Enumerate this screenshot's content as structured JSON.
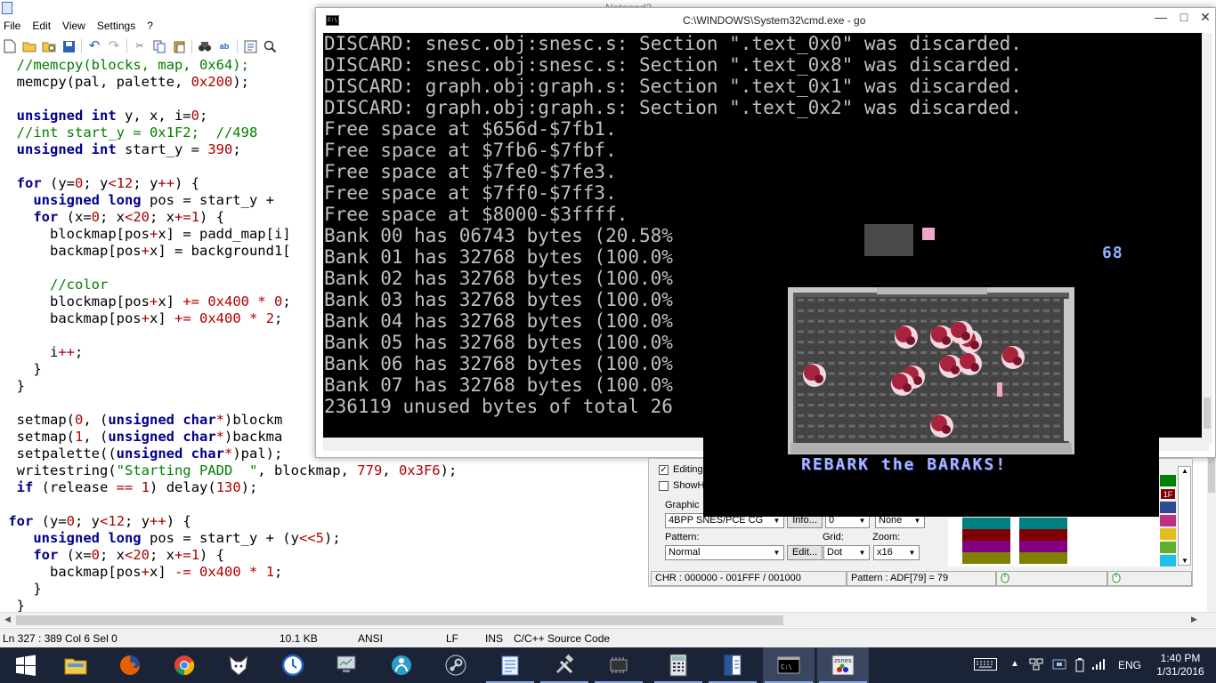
{
  "notepad": {
    "title": "Notepad2",
    "menu": [
      "File",
      "Edit",
      "View",
      "Settings",
      "?"
    ],
    "toolbar_icons": [
      "new-icon",
      "open-icon",
      "browse-icon",
      "save-icon",
      "undo-icon",
      "redo-icon",
      "cut-icon",
      "copy-icon",
      "paste-icon",
      "find-icon",
      "replace-icon",
      "word-wrap-icon",
      "zoom-icon"
    ],
    "code_lines": [
      [
        [
          "  ",
          ""
        ],
        [
          "//memcpy(blocks, map, 0x64);",
          "cm"
        ]
      ],
      [
        [
          "  memcpy(pal, palette, ",
          ""
        ],
        [
          "0x200",
          "nm"
        ],
        [
          ");",
          ""
        ]
      ],
      [
        [
          "",
          ""
        ]
      ],
      [
        [
          "  ",
          ""
        ],
        [
          "unsigned int",
          "kw"
        ],
        [
          " y, x, i=",
          ""
        ],
        [
          "0",
          "nm"
        ],
        [
          ";",
          ""
        ]
      ],
      [
        [
          "  ",
          ""
        ],
        [
          "//int start_y = 0x1F2;  //498",
          "cm"
        ]
      ],
      [
        [
          "  ",
          ""
        ],
        [
          "unsigned int",
          "kw"
        ],
        [
          " start_y = ",
          ""
        ],
        [
          "390",
          "nm"
        ],
        [
          ";",
          ""
        ]
      ],
      [
        [
          "",
          ""
        ]
      ],
      [
        [
          "  ",
          ""
        ],
        [
          "for",
          "kw"
        ],
        [
          " (y=",
          ""
        ],
        [
          "0",
          "nm"
        ],
        [
          "; y",
          ""
        ],
        [
          "<",
          "op"
        ],
        [
          "12",
          "nm"
        ],
        [
          "; y",
          ""
        ],
        [
          "++",
          "op"
        ],
        [
          ") {",
          ""
        ]
      ],
      [
        [
          "    ",
          ""
        ],
        [
          "unsigned long",
          "kw"
        ],
        [
          " pos = start_y + ",
          ""
        ]
      ],
      [
        [
          "    ",
          ""
        ],
        [
          "for",
          "kw"
        ],
        [
          " (x=",
          ""
        ],
        [
          "0",
          "nm"
        ],
        [
          "; x",
          ""
        ],
        [
          "<",
          "op"
        ],
        [
          "20",
          "nm"
        ],
        [
          "; x",
          ""
        ],
        [
          "+=",
          "op"
        ],
        [
          "1",
          "nm"
        ],
        [
          ") {",
          ""
        ]
      ],
      [
        [
          "      blockmap[pos",
          ""
        ],
        [
          "+",
          "op"
        ],
        [
          "x] = padd_map[i]",
          ""
        ]
      ],
      [
        [
          "      backmap[pos",
          ""
        ],
        [
          "+",
          "op"
        ],
        [
          "x] = background1[",
          ""
        ]
      ],
      [
        [
          "",
          ""
        ]
      ],
      [
        [
          "      ",
          ""
        ],
        [
          "//color",
          "cm"
        ]
      ],
      [
        [
          "      blockmap[pos",
          ""
        ],
        [
          "+",
          "op"
        ],
        [
          "x] ",
          ""
        ],
        [
          "+=",
          "op"
        ],
        [
          " ",
          ""
        ],
        [
          "0x400",
          "nm"
        ],
        [
          " ",
          ""
        ],
        [
          "*",
          "op"
        ],
        [
          " ",
          ""
        ],
        [
          "0",
          "nm"
        ],
        [
          ";",
          ""
        ]
      ],
      [
        [
          "      backmap[pos",
          ""
        ],
        [
          "+",
          "op"
        ],
        [
          "x] ",
          ""
        ],
        [
          "+=",
          "op"
        ],
        [
          " ",
          ""
        ],
        [
          "0x400",
          "nm"
        ],
        [
          " ",
          ""
        ],
        [
          "*",
          "op"
        ],
        [
          " ",
          ""
        ],
        [
          "2",
          "nm"
        ],
        [
          ";",
          ""
        ]
      ],
      [
        [
          "",
          ""
        ]
      ],
      [
        [
          "      i",
          ""
        ],
        [
          "++",
          "op"
        ],
        [
          ";",
          ""
        ]
      ],
      [
        [
          "    }",
          ""
        ]
      ],
      [
        [
          "  }",
          ""
        ]
      ],
      [
        [
          "",
          ""
        ]
      ],
      [
        [
          "  setmap(",
          ""
        ],
        [
          "0",
          "nm"
        ],
        [
          ", (",
          ""
        ],
        [
          "unsigned char",
          "kw"
        ],
        [
          "*",
          "op"
        ],
        [
          ")blockm",
          ""
        ]
      ],
      [
        [
          "  setmap(",
          ""
        ],
        [
          "1",
          "nm"
        ],
        [
          ", (",
          ""
        ],
        [
          "unsigned char",
          "kw"
        ],
        [
          "*",
          "op"
        ],
        [
          ")backma",
          ""
        ]
      ],
      [
        [
          "  setpalette((",
          ""
        ],
        [
          "unsigned char",
          "kw"
        ],
        [
          "*",
          "op"
        ],
        [
          ")pal);",
          ""
        ]
      ],
      [
        [
          "  writestring(",
          ""
        ],
        [
          "\"Starting PADD  \"",
          "st"
        ],
        [
          ", blockmap, ",
          ""
        ],
        [
          "779",
          "nm"
        ],
        [
          ", ",
          ""
        ],
        [
          "0x3F6",
          "nm"
        ],
        [
          ");",
          ""
        ]
      ],
      [
        [
          "  ",
          ""
        ],
        [
          "if",
          "kw"
        ],
        [
          " (release ",
          ""
        ],
        [
          "==",
          "op"
        ],
        [
          " ",
          ""
        ],
        [
          "1",
          "nm"
        ],
        [
          ") delay(",
          ""
        ],
        [
          "130",
          "nm"
        ],
        [
          ");",
          ""
        ]
      ],
      [
        [
          "",
          ""
        ]
      ],
      [
        [
          " ",
          ""
        ],
        [
          "for",
          "kw"
        ],
        [
          " (y=",
          ""
        ],
        [
          "0",
          "nm"
        ],
        [
          "; y",
          ""
        ],
        [
          "<",
          "op"
        ],
        [
          "12",
          "nm"
        ],
        [
          "; y",
          ""
        ],
        [
          "++",
          "op"
        ],
        [
          ") {",
          ""
        ]
      ],
      [
        [
          "    ",
          ""
        ],
        [
          "unsigned long",
          "kw"
        ],
        [
          " pos = start_y + (y",
          ""
        ],
        [
          "<<",
          "op"
        ],
        [
          "5",
          "nm"
        ],
        [
          ");",
          ""
        ]
      ],
      [
        [
          "    ",
          ""
        ],
        [
          "for",
          "kw"
        ],
        [
          " (x=",
          ""
        ],
        [
          "0",
          "nm"
        ],
        [
          "; x",
          ""
        ],
        [
          "<",
          "op"
        ],
        [
          "20",
          "nm"
        ],
        [
          "; x",
          ""
        ],
        [
          "+=",
          "op"
        ],
        [
          "1",
          "nm"
        ],
        [
          ") {",
          ""
        ]
      ],
      [
        [
          "      backmap[pos",
          ""
        ],
        [
          "+",
          "op"
        ],
        [
          "x] ",
          ""
        ],
        [
          "-=",
          "op"
        ],
        [
          " ",
          ""
        ],
        [
          "0x400",
          "nm"
        ],
        [
          " ",
          ""
        ],
        [
          "*",
          "op"
        ],
        [
          " ",
          ""
        ],
        [
          "1",
          "nm"
        ],
        [
          ";",
          ""
        ]
      ],
      [
        [
          "    }",
          ""
        ]
      ],
      [
        [
          "  }",
          ""
        ]
      ]
    ],
    "status": {
      "position": "Ln 327 : 389  Col 6  Sel 0",
      "size": "10.1 KB",
      "encoding": "ANSI",
      "line_ending": "LF",
      "mode": "INS",
      "scheme": "C/C++ Source Code"
    }
  },
  "cmd": {
    "title": "C:\\WINDOWS\\System32\\cmd.exe - go",
    "lines": [
      "DISCARD: snesc.obj:snesc.s: Section \".text_0x0\" was discarded.",
      "DISCARD: snesc.obj:snesc.s: Section \".text_0x8\" was discarded.",
      "DISCARD: graph.obj:graph.s: Section \".text_0x1\" was discarded.",
      "DISCARD: graph.obj:graph.s: Section \".text_0x2\" was discarded.",
      "Free space at $656d-$7fb1.",
      "Free space at $7fb6-$7fbf.",
      "Free space at $7fe0-$7fe3.",
      "Free space at $7ff0-$7ff3.",
      "Free space at $8000-$3ffff.",
      "Bank 00 has 06743 bytes (20.58%",
      "Bank 01 has 32768 bytes (100.0%",
      "Bank 02 has 32768 bytes (100.0%",
      "Bank 03 has 32768 bytes (100.0%",
      "Bank 04 has 32768 bytes (100.0%",
      "Bank 05 has 32768 bytes (100.0%",
      "Bank 06 has 32768 bytes (100.0%",
      "Bank 07 has 32768 bytes (100.0%",
      "236119 unused bytes of total 26"
    ],
    "text_color": "#c0c0c0",
    "background": "#000000"
  },
  "tile_editor": {
    "editing_label": "Editing",
    "show_label": "ShowH",
    "graphic_label": "Graphic",
    "graphic_value": "4BPP SNES/PCE CG",
    "info_button": "Info...",
    "graphic_num": "0",
    "graphic_none": "None",
    "pattern_label": "Pattern:",
    "pattern_value": "Normal",
    "edit_button": "Edit...",
    "grid_label": "Grid:",
    "grid_value": "Dot",
    "zoom_label": "Zoom:",
    "zoom_value": "x16",
    "chr_status": "CHR : 000000 - 001FFF / 001000",
    "pattern_status": "Pattern : ADF[79] = 79",
    "selected_index": "1F",
    "palette_colors": [
      "#008080",
      "#800000",
      "#800080",
      "#808000",
      "#000000",
      "#ff0000",
      "#ff00ff",
      "#ffff00",
      "#00ffff",
      "#000080",
      "#008000",
      "#c0c0c0"
    ]
  },
  "game": {
    "score": "68",
    "caption": "REBARK the BARAKS!",
    "score_color": "#8cb4ff"
  },
  "taskbar": {
    "apps": [
      "start-icon",
      "file-explorer-icon",
      "firefox-icon",
      "chrome-icon",
      "foobar-icon",
      "clock-app-icon",
      "monitor-icon",
      "network-icon",
      "steam-icon",
      "notepad2-icon",
      "tools-icon",
      "chip-icon",
      "calculator-icon",
      "document-icon",
      "cmd-icon",
      "zsnes-icon"
    ],
    "tray": [
      "keyboard-icon",
      "chevron-up-icon",
      "network-tray-icon",
      "tablet-icon",
      "battery-icon",
      "signal-icon"
    ],
    "language": "ENG",
    "time": "1:40 PM",
    "date": "1/31/2016"
  }
}
